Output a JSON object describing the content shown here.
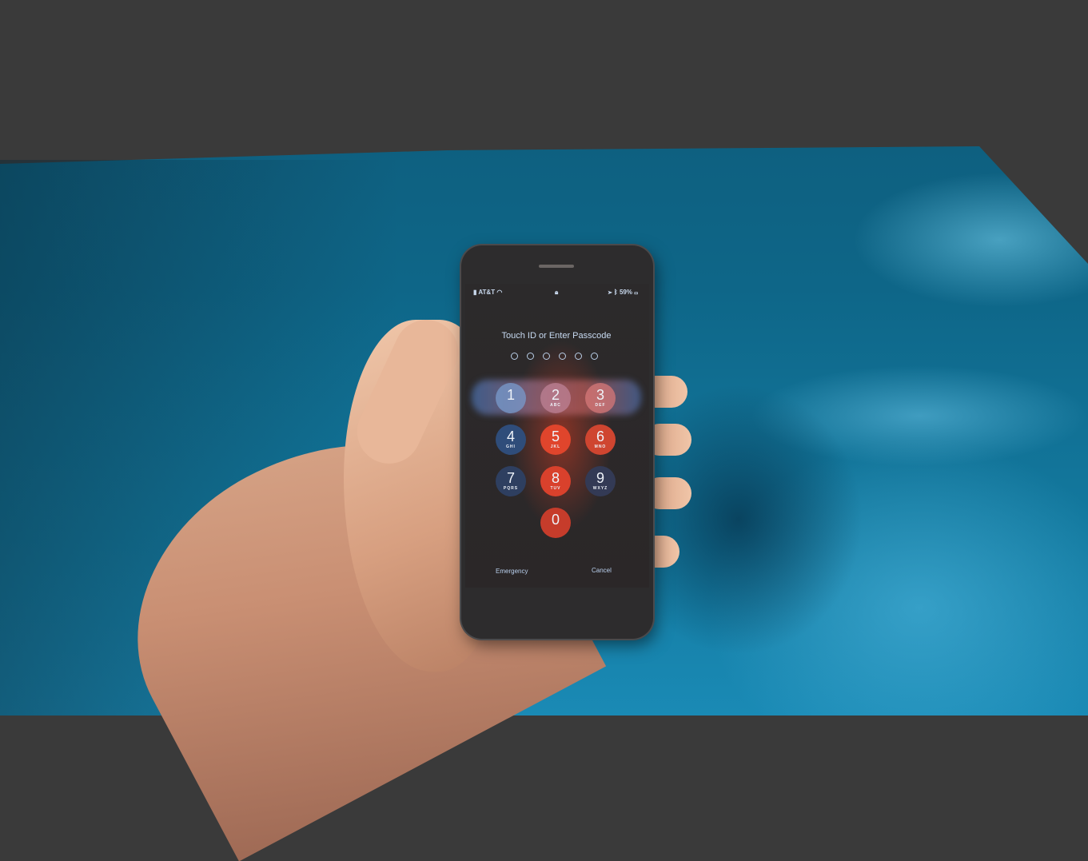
{
  "scene": {
    "description": "Hand holding an iPhone showing a lock screen passcode prompt on a blue table",
    "colors": {
      "background": "#3a3a3a",
      "table": "#137aa0",
      "phone_body": "#2d2c2d",
      "keypad_accent": "#e0452c"
    }
  },
  "phone": {
    "status_bar": {
      "carrier": "AT&T",
      "wifi_icon": "wifi-icon",
      "lock_icon": "lock-icon",
      "location_icon": "location-arrow-icon",
      "bluetooth_icon": "bluetooth-icon",
      "battery": "59%"
    },
    "prompt": "Touch ID or Enter Passcode",
    "passcode_length": 6,
    "keypad": [
      {
        "digit": "1",
        "letters": ""
      },
      {
        "digit": "2",
        "letters": "ABC"
      },
      {
        "digit": "3",
        "letters": "DEF"
      },
      {
        "digit": "4",
        "letters": "GHI"
      },
      {
        "digit": "5",
        "letters": "JKL"
      },
      {
        "digit": "6",
        "letters": "MNO"
      },
      {
        "digit": "7",
        "letters": "PQRS"
      },
      {
        "digit": "8",
        "letters": "TUV"
      },
      {
        "digit": "9",
        "letters": "WXYZ"
      },
      {
        "digit": "0",
        "letters": ""
      }
    ],
    "emergency_label": "Emergency",
    "cancel_label": "Cancel"
  }
}
